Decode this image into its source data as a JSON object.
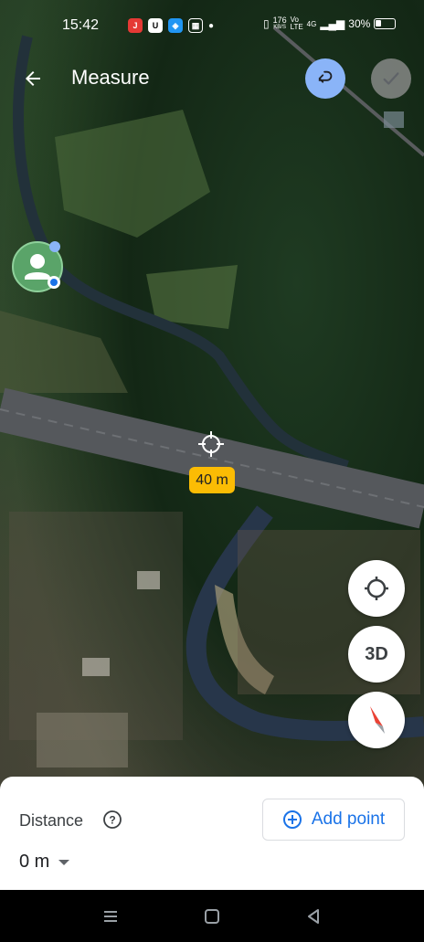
{
  "status_bar": {
    "time": "15:42",
    "network_speed": "176",
    "network_speed_unit": "KB/S",
    "volte": "Vo LTE",
    "signal": "4G",
    "battery_percent": "30%"
  },
  "header": {
    "title": "Measure"
  },
  "map": {
    "distance_label": "40 m",
    "controls": {
      "three_d_label": "3D"
    }
  },
  "bottom_sheet": {
    "distance_title": "Distance",
    "distance_value": "0 m",
    "add_point_label": "Add point"
  },
  "colors": {
    "accent": "#1a73e8",
    "undo_bg": "#8ab4f8",
    "distance_label_bg": "#fbbc04"
  },
  "icons": [
    "back-arrow-icon",
    "undo-icon",
    "check-icon",
    "help-icon",
    "add-circle-icon",
    "my-location-icon",
    "compass-icon"
  ]
}
